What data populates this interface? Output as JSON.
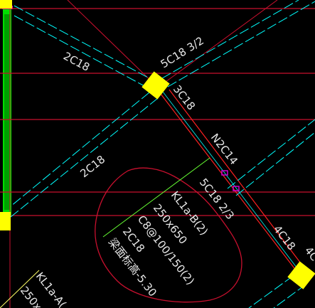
{
  "drawing": {
    "colors": {
      "background": "#000000",
      "axis_line": "#c8102e",
      "beam_dashed": "#00ffff",
      "beam_edge_red": "#ff2020",
      "column_fill": "#ffff00",
      "green_bar": "#00e000",
      "magenta_mark": "#d000d0",
      "cloud": "#c8102e",
      "leader_green": "#66ff33",
      "text": "#e8e8e8"
    },
    "annotations": {
      "left_beam_top": "2C18",
      "node_top": "5C18 3/2",
      "node_right": "3C18",
      "beam_mid_n": "N2C14",
      "beam_mid_5c": "5C18 2/3",
      "beam_lower_right": "4C18",
      "left_beam_lower": "2C18",
      "edge_right": "4C",
      "kl_tag": "KL1a-B(2)",
      "kl_size": "250x650",
      "kl_stirrup": "C8@100/150(2)",
      "kl_top_bars": "2C18",
      "kl_elevation": "梁面标高-5.30",
      "kl2_tag": "KL1a-A(",
      "kl2_size": "250x"
    },
    "icons": {
      "column": "column-icon"
    }
  }
}
